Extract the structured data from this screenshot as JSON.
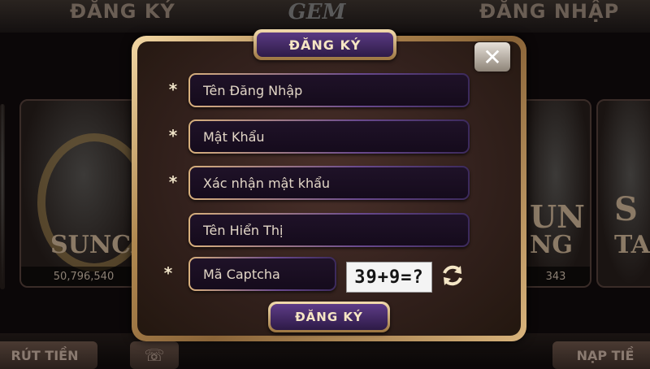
{
  "background": {
    "nav_left": "ĐĂNG KÝ",
    "nav_right": "ĐĂNG NHẬP",
    "logo": "GEM",
    "left_card": {
      "title": "SUNCA",
      "jackpot": "50,796,540"
    },
    "right_card": {
      "title_line1": "UN",
      "title_line2": "NG",
      "jackpot": "343"
    },
    "far_right_card": {
      "title_line1": "S",
      "title_line2": "TA"
    },
    "bottom_left": "RÚT TIỀN",
    "bottom_right": "NẠP TIỀ"
  },
  "modal": {
    "title": "ĐĂNG KÝ",
    "close_label": "✕",
    "fields": {
      "username": {
        "placeholder": "Tên Đăng Nhập",
        "required_mark": "*"
      },
      "password": {
        "placeholder": "Mật Khẩu",
        "required_mark": "*"
      },
      "confirm_password": {
        "placeholder": "Xác nhận mật khẩu",
        "required_mark": "*"
      },
      "display_name": {
        "placeholder": "Tên Hiển Thị"
      },
      "captcha": {
        "placeholder": "Mã Captcha",
        "required_mark": "*"
      }
    },
    "captcha_text": "39+9=?",
    "submit_label": "ĐĂNG KÝ"
  },
  "icons": {
    "close": "close-icon",
    "refresh": "refresh-icon"
  },
  "colors": {
    "gold_frame": "#b08850",
    "panel_bg": "#33211d",
    "purple_accent": "#5a3a82",
    "text_light": "#f6e6c4"
  }
}
